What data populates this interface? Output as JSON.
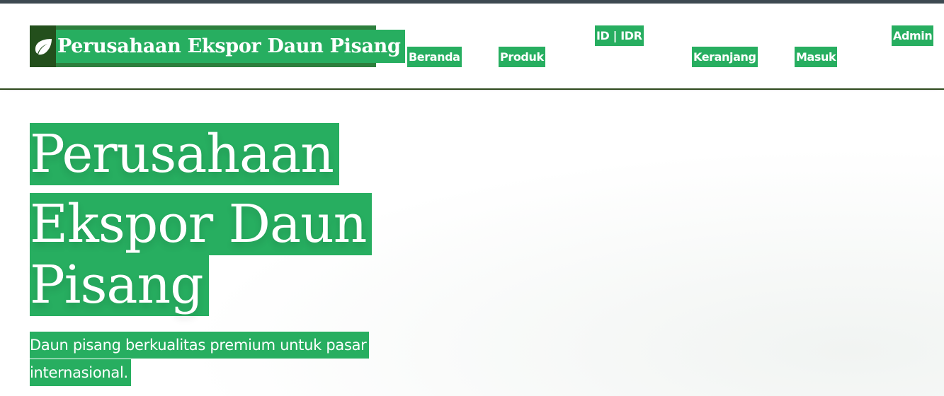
{
  "header": {
    "brand": {
      "icon": "leaf-icon",
      "title": "Perusahaan Ekspor Daun Pisang"
    },
    "nav": {
      "home": "Beranda",
      "products": "Produk",
      "lang_currency": "ID | IDR",
      "cart": "Keranjang",
      "login": "Masuk",
      "admin": "Admin"
    }
  },
  "hero": {
    "title_lines": [
      "Perusahaan",
      "Ekspor Daun",
      "Pisang"
    ],
    "subtitle_lines": [
      "Daun pisang berkualitas premium untuk pasar",
      "internasional."
    ]
  },
  "colors": {
    "accent": "#27ae60",
    "brand_dark": "#234f1c",
    "topbar": "#3e4a52"
  }
}
